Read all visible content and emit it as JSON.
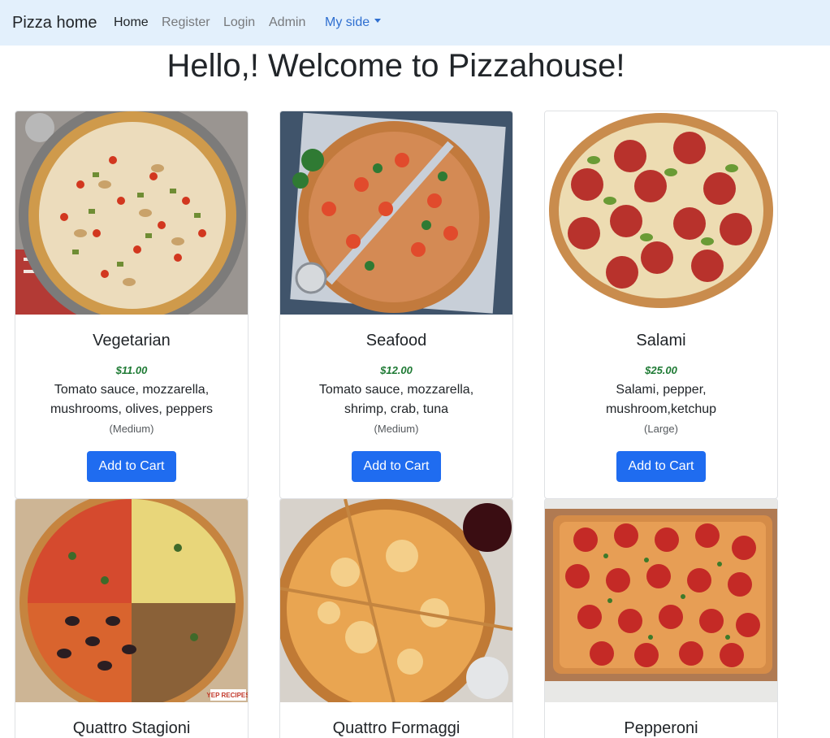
{
  "navbar": {
    "brand": "Pizza home",
    "links": [
      "Home",
      "Register",
      "Login",
      "Admin"
    ],
    "dropdown": "My side"
  },
  "heading": "Hello,! Welcome to Pizzahouse!",
  "colors": {
    "navbar_bg": "#e3f0fc",
    "button": "#1f6cf0",
    "price": "#1e7a34"
  },
  "pizzas": [
    {
      "name": "Vegetarian",
      "price": "$11.00",
      "description": "Tomato sauce, mozzarella, mushrooms, olives, peppers",
      "size": "(Medium)",
      "button": "Add to Cart"
    },
    {
      "name": "Seafood",
      "price": "$12.00",
      "description": "Tomato sauce, mozzarella, shrimp, crab, tuna",
      "size": "(Medium)",
      "button": "Add to Cart"
    },
    {
      "name": "Salami",
      "price": "$25.00",
      "description": "Salami, pepper, mushroom,ketchup",
      "size": "(Large)",
      "button": "Add to Cart"
    },
    {
      "name": "Quattro Stagioni"
    },
    {
      "name": "Quattro Formaggi"
    },
    {
      "name": "Pepperoni"
    }
  ],
  "image_watermark": "YEP RECIPES"
}
